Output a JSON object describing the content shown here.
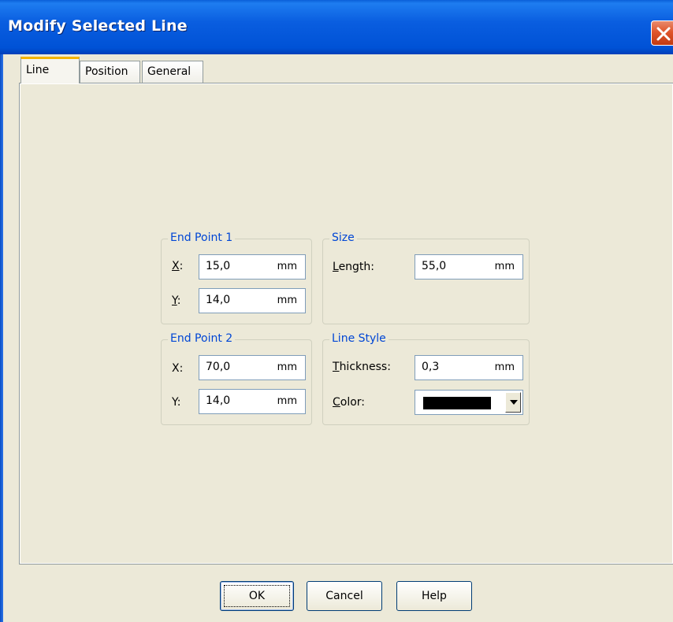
{
  "window": {
    "title": "Modify Selected Line",
    "close_icon": "close-icon"
  },
  "tabs": [
    {
      "label": "Line",
      "active": true
    },
    {
      "label": "Position",
      "active": false
    },
    {
      "label": "General",
      "active": false
    }
  ],
  "end_point_1": {
    "legend": "End Point 1",
    "x": {
      "mnemonic": "X",
      "rest": ":",
      "value": "15,0",
      "unit": "mm"
    },
    "y": {
      "mnemonic": "Y",
      "rest": ":",
      "value": "14,0",
      "unit": "mm"
    }
  },
  "end_point_2": {
    "legend": "End Point 2",
    "x": {
      "label": "X:",
      "value": "70,0",
      "unit": "mm"
    },
    "y": {
      "label": "Y:",
      "value": "14,0",
      "unit": "mm"
    }
  },
  "size": {
    "legend": "Size",
    "length": {
      "mnemonic": "L",
      "rest": "ength:",
      "value": "55,0",
      "unit": "mm"
    }
  },
  "line_style": {
    "legend": "Line Style",
    "thickness": {
      "mnemonic": "T",
      "rest": "hickness:",
      "value": "0,3",
      "unit": "mm"
    },
    "color": {
      "mnemonic": "C",
      "rest": "olor:",
      "value": "#000000"
    }
  },
  "buttons": {
    "ok": "OK",
    "cancel": "Cancel",
    "help": "Help"
  }
}
